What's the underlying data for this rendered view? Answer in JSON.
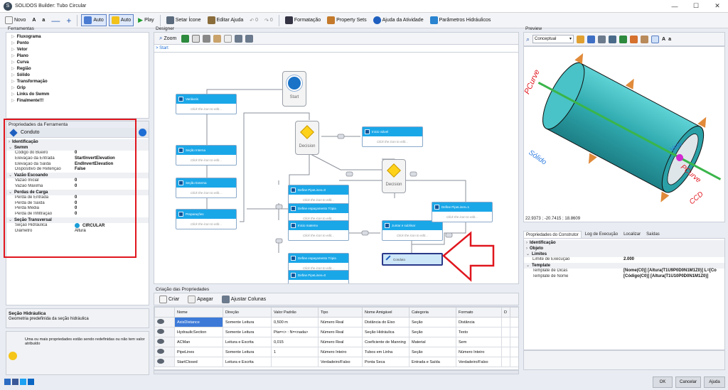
{
  "window": {
    "title": "SOLIDOS Builder: Tubo Circular"
  },
  "toolbar": {
    "novo": "Novo",
    "font_big": "A",
    "font_small": "a",
    "auto1": "Auto",
    "auto2": "Auto",
    "play": "Play",
    "setar_icone": "Setar Ícone",
    "editar_ajuda": "Editar Ajuda",
    "undo_count": "0",
    "redo_count": "0",
    "formatacao": "Formatação",
    "property_sets": "Property Sets",
    "ajuda_atividade": "Ajuda da Atividade",
    "parametros": "Parâmetros Hidráulicos"
  },
  "ferramentas": {
    "title": "Ferramentas",
    "items": [
      "Fluxograma",
      "Ponto",
      "Vetor",
      "Plano",
      "Curva",
      "Região",
      "Sólido",
      "Transformação",
      "Grip",
      "Links do Swmm",
      "Finalmente!!!"
    ]
  },
  "propriedades": {
    "title": "Propriedades da Ferramenta",
    "tool_name": "Conduto",
    "categories": [
      {
        "name": "Identificação",
        "rows": []
      },
      {
        "name": "Swmm",
        "rows": [
          {
            "k": "Código do Bueiro",
            "v": "0"
          },
          {
            "k": "Elevação da Entrada",
            "v": "StartInvertElevation"
          },
          {
            "k": "Elevação da Saída",
            "v": "EndInvertElevation"
          },
          {
            "k": "Dispositivo de Retenção",
            "v": "False"
          }
        ]
      },
      {
        "name": "Vazão Escoando",
        "rows": [
          {
            "k": "Vazão Inicial",
            "v": "0"
          },
          {
            "k": "Vazão Máxima",
            "v": "0"
          }
        ]
      },
      {
        "name": "Perdas de Carga",
        "rows": [
          {
            "k": "Perda de Entrada",
            "v": "0"
          },
          {
            "k": "Perda de Saída",
            "v": "0"
          },
          {
            "k": "Perda Média",
            "v": "0"
          },
          {
            "k": "Perda de Infiltração",
            "v": "0"
          }
        ]
      },
      {
        "name": "Seção Transversal",
        "rows": [
          {
            "k": "Seção Hidráulica",
            "v": "CIRCULAR"
          },
          {
            "k": "Diâmetro",
            "v": "Altura"
          }
        ]
      }
    ]
  },
  "help": {
    "title": "Seção Hidráulica",
    "text": "Geometria predefinida da seção hidráulica"
  },
  "warning": {
    "text": "Uma ou mais propriedades estão sendo redefinidas ou não tem valor atribuído"
  },
  "designer": {
    "title": "Designer",
    "zoom": "Zoom",
    "breadcrumb": "> Start",
    "placeholder": "Click the icon to edit...",
    "start_label": "Start",
    "decision_label": "Decision",
    "nodes": [
      "Variáveis",
      "Seção Interna",
      "Seção Externa",
      "Preparações",
      "Inicio viável",
      "Define PipeLines=0",
      "Define espaçamento Tópia",
      "Inicio matemo",
      "Define espaçamento Tópia",
      "Define PipeLines=0",
      "Juntar e sublinar",
      "Define PipeLines=1",
      "Conduto"
    ]
  },
  "criacao": {
    "title": "Criação das Propriedades",
    "criar": "Criar",
    "apagar": "Apagar",
    "ajustar": "Ajustar Colunas",
    "columns": [
      "Nome",
      "Direção",
      "Valor Padrão",
      "Tipo",
      "Nome Amigável",
      "Categoria",
      "Formato",
      "D"
    ],
    "rows": [
      [
        "AxisDistance",
        "Somente Leitura",
        "0,500 m",
        "Número Real",
        "Distância do Eixo",
        "Seção",
        "Distância",
        ""
      ],
      [
        "HydraulicSection",
        "Somente Leitura",
        "Pta=<> : N=<nada>",
        "Número Real",
        "Seção Hidráulica",
        "Seção",
        "Texto",
        ""
      ],
      [
        "ACMan",
        "Leitura e Escrita",
        "0,015",
        "Número Real",
        "Coeficiente de Manning",
        "Material",
        "Sem",
        ""
      ],
      [
        "PipeLines",
        "Somente Leitura",
        "1",
        "Número Inteiro",
        "Tubos em Linha",
        "Seção",
        "Número Inteiro",
        ""
      ],
      [
        "StartClosed",
        "Leitura e Escrita",
        "",
        "Verdadeiro/Falso",
        "Ponta Seca",
        "Entrada e Saída",
        "Verdadeiro/Falso",
        ""
      ]
    ]
  },
  "preview": {
    "title": "Preview",
    "view_mode": "Conceptual",
    "font_big": "A",
    "font_small": "a",
    "coords": "22.9373 ; -20.7415 ; 18.8609",
    "labels": {
      "pcurve": "PCurve",
      "solido": "Sólido",
      "pbca": "PCurve",
      "ccd": "CCD",
      "vela": "Vela"
    }
  },
  "construtor": {
    "tabs": [
      "Propriedades do Construtor",
      "Log de Execução",
      "Localizar",
      "Saídas"
    ],
    "categories": [
      {
        "name": "Identificação",
        "rows": []
      },
      {
        "name": "Objeto",
        "rows": []
      },
      {
        "name": "Limites",
        "rows": [
          {
            "k": "Limite de Execução",
            "v": "2.000"
          }
        ]
      },
      {
        "name": "Template",
        "rows": [
          {
            "k": "Template de Dicas",
            "v": "[Nome(C0)] [Altura(T1U9P0D0N1M1Z0)] L=[Co"
          },
          {
            "k": "Template de Nome",
            "v": "[Código(C0)] [Altura(T1U10P0D0N1M1Z0)]"
          }
        ]
      }
    ]
  },
  "footer": {
    "ok": "OK",
    "cancelar": "Cancelar",
    "ajuda": "Ajuda"
  },
  "colors": {
    "accent": "#1aa7e8",
    "highlight_red": "#e0161e",
    "selection": "#3d7ad8"
  }
}
